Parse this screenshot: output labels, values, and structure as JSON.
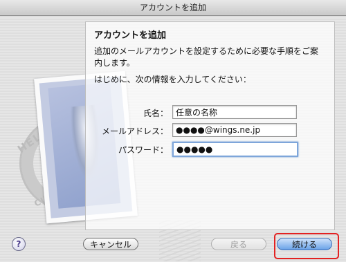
{
  "window": {
    "title": "アカウントを追加"
  },
  "stamp": {
    "postmark_top": "HELLO FR",
    "postmark_bottom": "CUPERTINO C"
  },
  "panel": {
    "title": "アカウントを追加",
    "description": "追加のメールアカウントを設定するために必要な手順をご案内します。",
    "intro": "はじめに、次の情報を入力してください："
  },
  "form": {
    "name_label": "氏名：",
    "name_value": "任意の名称",
    "email_label": "メールアドレス：",
    "email_value": "●●●●@wings.ne.jp",
    "password_label": "パスワード：",
    "password_value": "●●●●●"
  },
  "buttons": {
    "help": "?",
    "cancel": "キャンセル",
    "back": "戻る",
    "continue": "続ける"
  }
}
